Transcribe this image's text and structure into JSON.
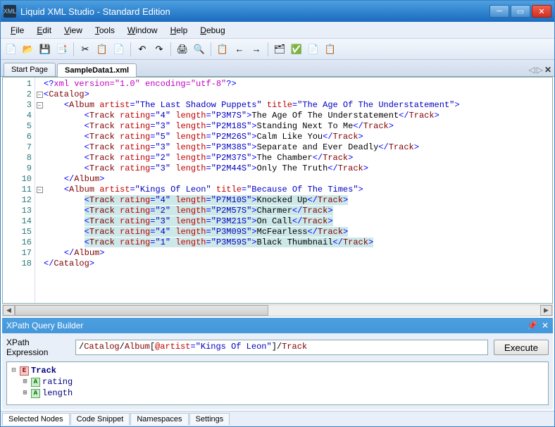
{
  "window": {
    "title": "Liquid XML Studio - Standard Edition"
  },
  "menu": {
    "file": "File",
    "edit": "Edit",
    "view": "View",
    "tools": "Tools",
    "window": "Window",
    "help": "Help",
    "debug": "Debug"
  },
  "tabs": {
    "start": "Start Page",
    "active": "SampleData1.xml"
  },
  "code_lines": [
    {
      "n": 1,
      "fold": "",
      "html": "<span class='t-ab'>&lt;?</span><span class='t-pi'>xml version=\"1.0\" encoding=\"utf-8\"</span><span class='t-ab'>?&gt;</span>"
    },
    {
      "n": 2,
      "fold": "box",
      "html": "<span class='t-ab'>&lt;</span><span class='t-el'>Catalog</span><span class='t-ab'>&gt;</span>"
    },
    {
      "n": 3,
      "fold": "box",
      "html": "    <span class='t-ab'>&lt;</span><span class='t-el'>Album</span> <span class='t-attr'>artist</span><span class='t-eq'>=</span><span class='t-val'>\"The Last Shadow Puppets\"</span> <span class='t-attr'>title</span><span class='t-eq'>=</span><span class='t-val'>\"The Age Of The Understatement\"</span><span class='t-ab'>&gt;</span>"
    },
    {
      "n": 4,
      "fold": "",
      "html": "        <span class='t-ab'>&lt;</span><span class='t-el'>Track</span> <span class='t-attr'>rating</span><span class='t-eq'>=</span><span class='t-val'>\"4\"</span> <span class='t-attr'>length</span><span class='t-eq'>=</span><span class='t-val'>\"P3M7S\"</span><span class='t-ab'>&gt;</span><span class='t-txt'>The Age Of The Understatement</span><span class='t-ab'>&lt;/</span><span class='t-el'>Track</span><span class='t-ab'>&gt;</span>"
    },
    {
      "n": 5,
      "fold": "",
      "html": "        <span class='t-ab'>&lt;</span><span class='t-el'>Track</span> <span class='t-attr'>rating</span><span class='t-eq'>=</span><span class='t-val'>\"3\"</span> <span class='t-attr'>length</span><span class='t-eq'>=</span><span class='t-val'>\"P2M18S\"</span><span class='t-ab'>&gt;</span><span class='t-txt'>Standing Next To Me</span><span class='t-ab'>&lt;/</span><span class='t-el'>Track</span><span class='t-ab'>&gt;</span>"
    },
    {
      "n": 6,
      "fold": "",
      "html": "        <span class='t-ab'>&lt;</span><span class='t-el'>Track</span> <span class='t-attr'>rating</span><span class='t-eq'>=</span><span class='t-val'>\"5\"</span> <span class='t-attr'>length</span><span class='t-eq'>=</span><span class='t-val'>\"P2M26S\"</span><span class='t-ab'>&gt;</span><span class='t-txt'>Calm Like You</span><span class='t-ab'>&lt;/</span><span class='t-el'>Track</span><span class='t-ab'>&gt;</span>"
    },
    {
      "n": 7,
      "fold": "",
      "html": "        <span class='t-ab'>&lt;</span><span class='t-el'>Track</span> <span class='t-attr'>rating</span><span class='t-eq'>=</span><span class='t-val'>\"3\"</span> <span class='t-attr'>length</span><span class='t-eq'>=</span><span class='t-val'>\"P3M38S\"</span><span class='t-ab'>&gt;</span><span class='t-txt'>Separate and Ever Deadly</span><span class='t-ab'>&lt;/</span><span class='t-el'>Track</span><span class='t-ab'>&gt;</span>"
    },
    {
      "n": 8,
      "fold": "",
      "html": "        <span class='t-ab'>&lt;</span><span class='t-el'>Track</span> <span class='t-attr'>rating</span><span class='t-eq'>=</span><span class='t-val'>\"2\"</span> <span class='t-attr'>length</span><span class='t-eq'>=</span><span class='t-val'>\"P2M37S\"</span><span class='t-ab'>&gt;</span><span class='t-txt'>The Chamber</span><span class='t-ab'>&lt;/</span><span class='t-el'>Track</span><span class='t-ab'>&gt;</span>"
    },
    {
      "n": 9,
      "fold": "",
      "html": "        <span class='t-ab'>&lt;</span><span class='t-el'>Track</span> <span class='t-attr'>rating</span><span class='t-eq'>=</span><span class='t-val'>\"3\"</span> <span class='t-attr'>length</span><span class='t-eq'>=</span><span class='t-val'>\"P2M44S\"</span><span class='t-ab'>&gt;</span><span class='t-txt'>Only The Truth</span><span class='t-ab'>&lt;/</span><span class='t-el'>Track</span><span class='t-ab'>&gt;</span>"
    },
    {
      "n": 10,
      "fold": "",
      "html": "    <span class='t-ab'>&lt;/</span><span class='t-el'>Album</span><span class='t-ab'>&gt;</span>"
    },
    {
      "n": 11,
      "fold": "box",
      "html": "    <span class='t-ab'>&lt;</span><span class='t-el'>Album</span> <span class='t-attr'>artist</span><span class='t-eq'>=</span><span class='t-val'>\"Kings Of Leon\"</span> <span class='t-attr'>title</span><span class='t-eq'>=</span><span class='t-val'>\"Because Of The Times\"</span><span class='t-ab'>&gt;</span>"
    },
    {
      "n": 12,
      "fold": "",
      "sel": true,
      "html": "        <span class='sel'><span class='t-ab'>&lt;</span><span class='t-el'>Track</span> <span class='t-attr'>rating</span><span class='t-eq'>=</span><span class='t-val'>\"4\"</span> <span class='t-attr'>length</span><span class='t-eq'>=</span><span class='t-val'>\"P7M10S\"</span><span class='t-ab'>&gt;</span><span class='t-txt'>Knocked Up</span><span class='t-ab'>&lt;/</span><span class='t-el'>Track</span><span class='t-ab'>&gt;</span></span>"
    },
    {
      "n": 13,
      "fold": "",
      "sel": true,
      "html": "        <span class='sel'><span class='t-ab'>&lt;</span><span class='t-el'>Track</span> <span class='t-attr'>rating</span><span class='t-eq'>=</span><span class='t-val'>\"2\"</span> <span class='t-attr'>length</span><span class='t-eq'>=</span><span class='t-val'>\"P2M57S\"</span><span class='t-ab'>&gt;</span><span class='t-txt'>Charmer</span><span class='t-ab'>&lt;/</span><span class='t-el'>Track</span><span class='t-ab'>&gt;</span></span>"
    },
    {
      "n": 14,
      "fold": "",
      "sel": true,
      "html": "        <span class='sel'><span class='t-ab'>&lt;</span><span class='t-el'>Track</span> <span class='t-attr'>rating</span><span class='t-eq'>=</span><span class='t-val'>\"3\"</span> <span class='t-attr'>length</span><span class='t-eq'>=</span><span class='t-val'>\"P3M21S\"</span><span class='t-ab'>&gt;</span><span class='t-txt'>On Call</span><span class='t-ab'>&lt;/</span><span class='t-el'>Track</span><span class='t-ab'>&gt;</span></span>"
    },
    {
      "n": 15,
      "fold": "",
      "sel": true,
      "html": "        <span class='sel'><span class='t-ab'>&lt;</span><span class='t-el'>Track</span> <span class='t-attr'>rating</span><span class='t-eq'>=</span><span class='t-val'>\"4\"</span> <span class='t-attr'>length</span><span class='t-eq'>=</span><span class='t-val'>\"P3M09S\"</span><span class='t-ab'>&gt;</span><span class='t-txt'>McFearless</span><span class='t-ab'>&lt;/</span><span class='t-el'>Track</span><span class='t-ab'>&gt;</span></span>"
    },
    {
      "n": 16,
      "fold": "",
      "sel": true,
      "html": "        <span class='sel'><span class='t-ab'>&lt;</span><span class='t-el'>Track</span> <span class='t-attr'>rating</span><span class='t-eq'>=</span><span class='t-val'>\"1\"</span> <span class='t-attr'>length</span><span class='t-eq'>=</span><span class='t-val'>\"P3M59S\"</span><span class='t-ab'>&gt;</span><span class='t-txt'>Black Thumbnail</span><span class='t-ab'>&lt;/</span><span class='t-el'>Track</span><span class='t-ab'>&gt;</span></span>"
    },
    {
      "n": 17,
      "fold": "",
      "html": "    <span class='t-ab'>&lt;/</span><span class='t-el'>Album</span><span class='t-ab'>&gt;</span>"
    },
    {
      "n": 18,
      "fold": "",
      "html": "<span class='t-ab'>&lt;/</span><span class='t-el'>Catalog</span><span class='t-ab'>&gt;</span>"
    }
  ],
  "xpath": {
    "panel_title": "XPath Query Builder",
    "label": "XPath Expression",
    "expression_html": "<span class='t-txt'>/</span><span class='t-el'>Catalog</span><span class='t-txt'>/</span><span class='t-el'>Album</span><span class='t-txt'>[</span><span class='t-attr'>@artist</span><span class='t-eq'>=</span><span class='t-val'>\"Kings Of Leon\"</span><span class='t-txt'>]/</span><span class='t-el'>Track</span>",
    "execute": "Execute",
    "tree": [
      {
        "indent": 0,
        "tog": "−",
        "badge": "E",
        "name": "Track",
        "sel": true
      },
      {
        "indent": 1,
        "tog": "+",
        "badge": "A",
        "name": "rating"
      },
      {
        "indent": 1,
        "tog": "+",
        "badge": "A",
        "name": "length"
      }
    ]
  },
  "bottom_tabs": [
    "Selected Nodes",
    "Code Snippet",
    "Namespaces",
    "Settings"
  ],
  "toolbar_icons": [
    "📄",
    "📂",
    "💾",
    "📑",
    "|",
    "✂",
    "📋",
    "📄",
    "|",
    "↶",
    "↷",
    "|",
    "🖨",
    "🔍",
    "|",
    "📋",
    "←",
    "→",
    "|",
    "🗂",
    "✅",
    "📄",
    "📋"
  ]
}
